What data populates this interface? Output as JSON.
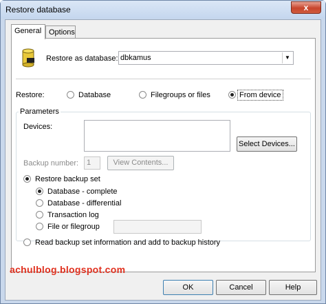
{
  "window": {
    "title": "Restore database",
    "close_glyph": "x"
  },
  "tabs": [
    {
      "label": "General"
    },
    {
      "label": "Options"
    }
  ],
  "restore_as": {
    "label": "Restore as database:",
    "value": "dbkamus",
    "icon": "database-icon"
  },
  "restore": {
    "label": "Restore:",
    "options": [
      {
        "label": "Database",
        "selected": false
      },
      {
        "label": "Filegroups or files",
        "selected": false
      },
      {
        "label": "From device",
        "selected": true
      }
    ]
  },
  "parameters": {
    "legend": "Parameters",
    "devices_label": "Devices:",
    "select_devices_button": "Select Devices...",
    "backup_number_label": "Backup number:",
    "backup_number_value": "1",
    "view_contents_button": "View Contents...",
    "restore_backup_set_label": "Restore backup set",
    "backup_types": [
      {
        "label": "Database - complete",
        "selected": true
      },
      {
        "label": "Database - differential",
        "selected": false
      },
      {
        "label": "Transaction log",
        "selected": false
      },
      {
        "label": "File or filegroup",
        "selected": false
      }
    ],
    "read_info_label": "Read backup set information and add to backup history"
  },
  "footer": {
    "watermark": "achulblog.blogspot.com",
    "ok": "OK",
    "cancel": "Cancel",
    "help": "Help"
  }
}
